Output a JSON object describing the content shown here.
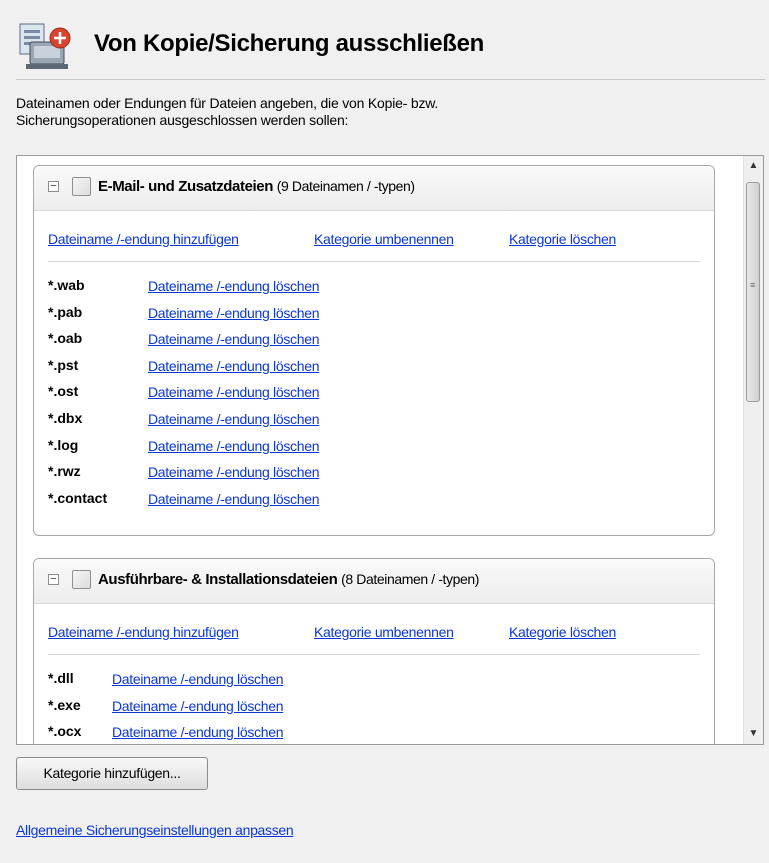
{
  "header": {
    "icon": "backup-exclude-icon",
    "title": "Von Kopie/Sicherung ausschließen"
  },
  "description": {
    "line1": "Dateinamen oder Endungen für Dateien angeben, die von Kopie- bzw.",
    "line2": "Sicherungsoperationen ausgeschlossen werden sollen:"
  },
  "categories": [
    {
      "name": "E-Mail- und Zusatzdateien",
      "count": "(9 Dateinamen / -typen)",
      "expander": "−",
      "checked": false,
      "actions": {
        "add": "Dateiname /-endung hinzufügen",
        "rename": "Kategorie umbenennen",
        "delete": "Kategorie löschen"
      },
      "files": [
        {
          "ext": "*.wab",
          "delete": "Dateiname /-endung löschen"
        },
        {
          "ext": "*.pab",
          "delete": "Dateiname /-endung löschen"
        },
        {
          "ext": "*.oab",
          "delete": "Dateiname /-endung löschen"
        },
        {
          "ext": "*.pst",
          "delete": "Dateiname /-endung löschen"
        },
        {
          "ext": "*.ost",
          "delete": "Dateiname /-endung löschen"
        },
        {
          "ext": "*.dbx",
          "delete": "Dateiname /-endung löschen"
        },
        {
          "ext": "*.log",
          "delete": "Dateiname /-endung löschen"
        },
        {
          "ext": "*.rwz",
          "delete": "Dateiname /-endung löschen"
        },
        {
          "ext": "*.contact",
          "delete": "Dateiname /-endung löschen"
        }
      ]
    },
    {
      "name": "Ausführbare- & Installationsdateien",
      "count": "(8 Dateinamen / -typen)",
      "expander": "−",
      "checked": false,
      "actions": {
        "add": "Dateiname /-endung hinzufügen",
        "rename": "Kategorie umbenennen",
        "delete": "Kategorie löschen"
      },
      "files": [
        {
          "ext": "*.dll",
          "delete": "Dateiname /-endung löschen"
        },
        {
          "ext": "*.exe",
          "delete": "Dateiname /-endung löschen"
        },
        {
          "ext": "*.ocx",
          "delete": "Dateiname /-endung löschen"
        }
      ]
    }
  ],
  "scrollbar": {
    "up": "▲",
    "down": "▼",
    "grip": "≡"
  },
  "buttons": {
    "add_category": "Kategorie hinzufügen..."
  },
  "footer": {
    "link": "Allgemeine Sicherungseinstellungen anpassen"
  },
  "colors": {
    "link": "#0b36d6",
    "background": "#f0f0f0"
  }
}
